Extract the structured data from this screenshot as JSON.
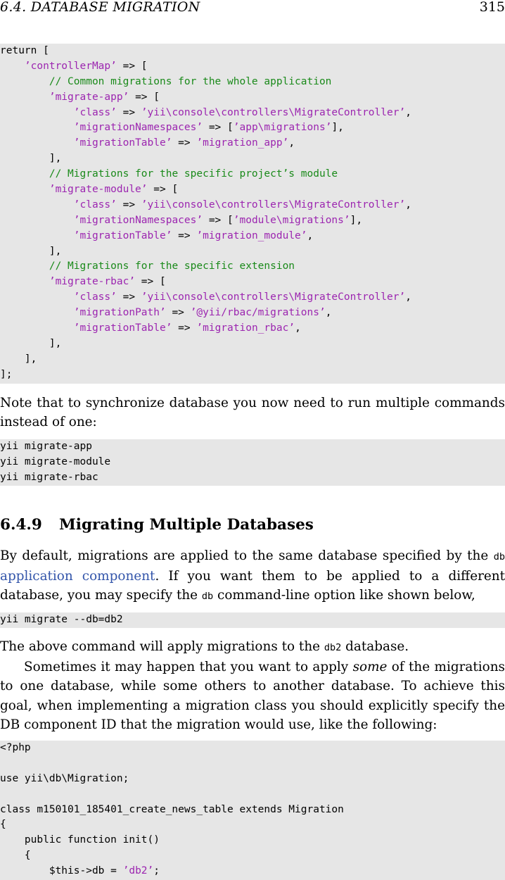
{
  "header": {
    "section": "6.4.  DATABASE MIGRATION",
    "page_number": "315"
  },
  "code1": [
    [
      [
        "t",
        "return ["
      ]
    ],
    [
      [
        "t",
        "    "
      ],
      [
        "s",
        "’controllerMap’"
      ],
      [
        "t",
        " => ["
      ]
    ],
    [
      [
        "t",
        "        "
      ],
      [
        "c",
        "// Common migrations for the whole application"
      ]
    ],
    [
      [
        "t",
        "        "
      ],
      [
        "s",
        "’migrate-app’"
      ],
      [
        "t",
        " => ["
      ]
    ],
    [
      [
        "t",
        "            "
      ],
      [
        "s",
        "’class’"
      ],
      [
        "t",
        " => "
      ],
      [
        "s",
        "’yii\\console\\controllers\\MigrateController’"
      ],
      [
        "t",
        ","
      ]
    ],
    [
      [
        "t",
        "            "
      ],
      [
        "s",
        "’migrationNamespaces’"
      ],
      [
        "t",
        " => ["
      ],
      [
        "s",
        "’app\\migrations’"
      ],
      [
        "t",
        "],"
      ]
    ],
    [
      [
        "t",
        "            "
      ],
      [
        "s",
        "’migrationTable’"
      ],
      [
        "t",
        " => "
      ],
      [
        "s",
        "’migration_app’"
      ],
      [
        "t",
        ","
      ]
    ],
    [
      [
        "t",
        "        ],"
      ]
    ],
    [
      [
        "t",
        "        "
      ],
      [
        "c",
        "// Migrations for the specific project’s module"
      ]
    ],
    [
      [
        "t",
        "        "
      ],
      [
        "s",
        "’migrate-module’"
      ],
      [
        "t",
        " => ["
      ]
    ],
    [
      [
        "t",
        "            "
      ],
      [
        "s",
        "’class’"
      ],
      [
        "t",
        " => "
      ],
      [
        "s",
        "’yii\\console\\controllers\\MigrateController’"
      ],
      [
        "t",
        ","
      ]
    ],
    [
      [
        "t",
        "            "
      ],
      [
        "s",
        "’migrationNamespaces’"
      ],
      [
        "t",
        " => ["
      ],
      [
        "s",
        "’module\\migrations’"
      ],
      [
        "t",
        "],"
      ]
    ],
    [
      [
        "t",
        "            "
      ],
      [
        "s",
        "’migrationTable’"
      ],
      [
        "t",
        " => "
      ],
      [
        "s",
        "’migration_module’"
      ],
      [
        "t",
        ","
      ]
    ],
    [
      [
        "t",
        "        ],"
      ]
    ],
    [
      [
        "t",
        "        "
      ],
      [
        "c",
        "// Migrations for the specific extension"
      ]
    ],
    [
      [
        "t",
        "        "
      ],
      [
        "s",
        "’migrate-rbac’"
      ],
      [
        "t",
        " => ["
      ]
    ],
    [
      [
        "t",
        "            "
      ],
      [
        "s",
        "’class’"
      ],
      [
        "t",
        " => "
      ],
      [
        "s",
        "’yii\\console\\controllers\\MigrateController’"
      ],
      [
        "t",
        ","
      ]
    ],
    [
      [
        "t",
        "            "
      ],
      [
        "s",
        "’migrationPath’"
      ],
      [
        "t",
        " => "
      ],
      [
        "s",
        "’@yii/rbac/migrations’"
      ],
      [
        "t",
        ","
      ]
    ],
    [
      [
        "t",
        "            "
      ],
      [
        "s",
        "’migrationTable’"
      ],
      [
        "t",
        " => "
      ],
      [
        "s",
        "’migration_rbac’"
      ],
      [
        "t",
        ","
      ]
    ],
    [
      [
        "t",
        "        ],"
      ]
    ],
    [
      [
        "t",
        "    ],"
      ]
    ],
    [
      [
        "t",
        "];"
      ]
    ]
  ],
  "para1": "Note that to synchronize database you now need to run multiple commands instead of one:",
  "code2": [
    [
      [
        "t",
        "yii migrate-app"
      ]
    ],
    [
      [
        "t",
        "yii migrate-module"
      ]
    ],
    [
      [
        "t",
        "yii migrate-rbac"
      ]
    ]
  ],
  "section": {
    "number": "6.4.9",
    "title": "Migrating Multiple Databases"
  },
  "para2": {
    "t1": "By default, migrations are applied to the same database specified by the ",
    "code_db": "db",
    "link": "application component",
    "t2": ".  If you want them to be applied to a different database, you may specify the ",
    "code_db2": "db",
    "t3": " command-line option like shown below,"
  },
  "code3": [
    [
      [
        "t",
        "yii migrate --db=db2"
      ]
    ]
  ],
  "para3": {
    "t1": "The above command will apply migrations to the ",
    "code": "db2",
    "t2": " database."
  },
  "para4": {
    "t1": "Sometimes it may happen that you want to apply ",
    "em": "some",
    "t2": " of the migrations to one database, while some others to another database. To achieve this goal, when implementing a migration class you should explicitly specify the DB component ID that the migration would use, like the following:"
  },
  "code4": [
    [
      [
        "t",
        "<?php"
      ]
    ],
    [
      [
        "t",
        ""
      ]
    ],
    [
      [
        "t",
        "use yii\\db\\Migration;"
      ]
    ],
    [
      [
        "t",
        ""
      ]
    ],
    [
      [
        "t",
        "class m150101_185401_create_news_table extends Migration"
      ]
    ],
    [
      [
        "t",
        "{"
      ]
    ],
    [
      [
        "t",
        "    public function init()"
      ]
    ],
    [
      [
        "t",
        "    {"
      ]
    ],
    [
      [
        "t",
        "        $this->db = "
      ],
      [
        "s",
        "’db2’"
      ],
      [
        "t",
        ";"
      ]
    ]
  ]
}
